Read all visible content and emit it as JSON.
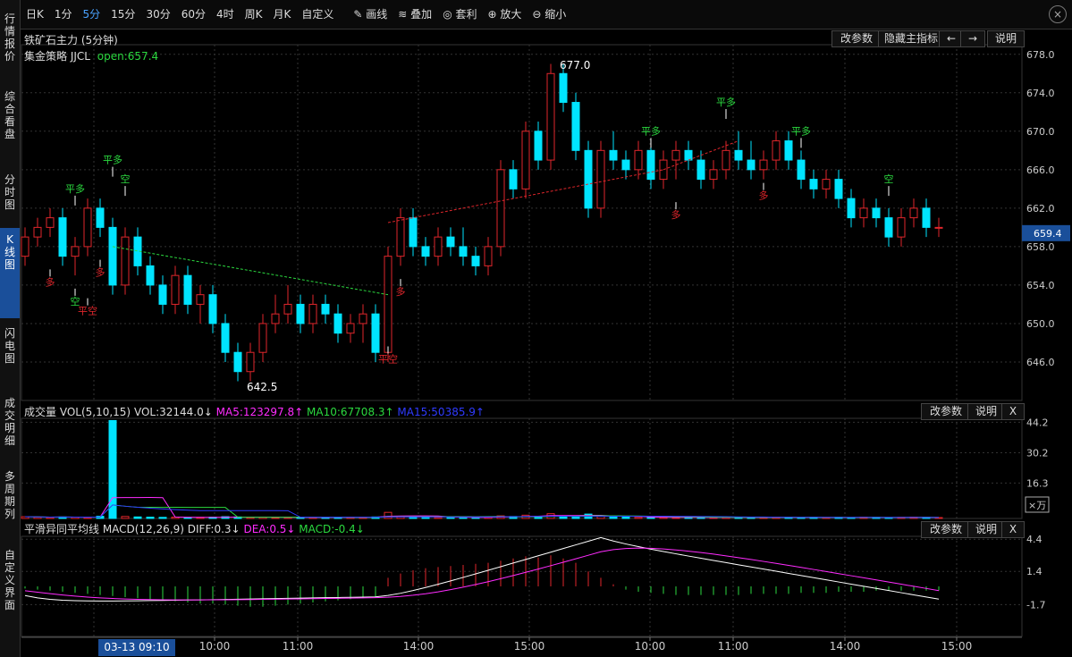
{
  "toolbar": {
    "items": [
      "日K",
      "1分",
      "5分",
      "15分",
      "30分",
      "60分",
      "4时",
      "周K",
      "月K",
      "自定义",
      "画线",
      "叠加",
      "套利",
      "放大",
      "缩小"
    ],
    "active_index": 2,
    "icons": {
      "10": "pencil-icon",
      "11": "layers-icon",
      "12": "coin-icon",
      "13": "zoom-in-icon",
      "14": "zoom-out-icon"
    }
  },
  "sidebar": [
    {
      "label": "行情报价",
      "name": "sidebar-quote"
    },
    {
      "label": "综合看盘",
      "name": "sidebar-overview"
    },
    {
      "label": "分时图",
      "name": "sidebar-timeshare"
    },
    {
      "label": "K线图",
      "name": "sidebar-kline",
      "active": true
    },
    {
      "label": "闪电图",
      "name": "sidebar-flash"
    },
    {
      "label": "成交明细",
      "name": "sidebar-trades"
    },
    {
      "label": "多周期列",
      "name": "sidebar-multiperiod"
    },
    {
      "label": "自定义界面",
      "name": "sidebar-custom"
    }
  ],
  "main": {
    "title": "铁矿石主力 (5分钟)",
    "strategy": "集金策略 JJCL",
    "open_label": "open:657.4",
    "buttons": [
      "改参数",
      "隐藏主指标",
      "←",
      "→",
      "说明"
    ],
    "price_axis": [
      "678.0",
      "674.0",
      "670.0",
      "666.0",
      "662.0",
      "658.0",
      "654.0",
      "650.0",
      "646.0"
    ],
    "current_price": "659.4",
    "high_label": "677.0",
    "low_label": "642.5"
  },
  "volume": {
    "label": "成交量 VOL(5,10,15)",
    "vol": "VOL:32144.0↓",
    "ma5": "MA5:123297.8↑",
    "ma10": "MA10:67708.3↑",
    "ma15": "MA15:50385.9↑",
    "axis": [
      "44.2",
      "30.2",
      "16.3"
    ],
    "unit": "×万",
    "buttons": [
      "改参数",
      "说明",
      "X"
    ]
  },
  "macd": {
    "label": "平滑异同平均线 MACD(12,26,9)",
    "diff": "DIFF:0.3↓",
    "dea": "DEA:0.5↓",
    "macd": "MACD:-0.4↓",
    "axis": [
      "4.4",
      "1.4",
      "-1.7"
    ],
    "buttons": [
      "改参数",
      "说明",
      "X"
    ]
  },
  "time_axis": {
    "labels": [
      "10:00",
      "11:00",
      "14:00",
      "15:00",
      "10:00",
      "11:00",
      "14:00",
      "15:00"
    ],
    "cursor": "03-13 09:10"
  },
  "signals": {
    "duo": "多",
    "kong": "空",
    "pingduo": "平多",
    "pingkong": "平空"
  },
  "colors": {
    "up": "#e0262b",
    "down": "#00e4ff",
    "ma5": "#ff2cff",
    "ma10": "#2bd93f",
    "ma15": "#2f3bff",
    "diff": "#ffffff",
    "dea": "#ff2cff"
  },
  "chart_data": {
    "type": "candlestick",
    "title": "铁矿石主力 (5分钟)",
    "y_range": [
      642,
      679
    ],
    "series": [
      {
        "name": "K线",
        "ohlc": [
          [
            657,
            660,
            656,
            659
          ],
          [
            659,
            661,
            658,
            660
          ],
          [
            660,
            662,
            659,
            661
          ],
          [
            661,
            662,
            656,
            657
          ],
          [
            657,
            659,
            655,
            658
          ],
          [
            658,
            663,
            657,
            662
          ],
          [
            662,
            663,
            659,
            660
          ],
          [
            660,
            661,
            653,
            654
          ],
          [
            654,
            660,
            653,
            659
          ],
          [
            659,
            660,
            655,
            656
          ],
          [
            656,
            657,
            653,
            654
          ],
          [
            654,
            655,
            651,
            652
          ],
          [
            652,
            656,
            651,
            655
          ],
          [
            655,
            656,
            651,
            652
          ],
          [
            652,
            654,
            650,
            653
          ],
          [
            653,
            654,
            649,
            650
          ],
          [
            650,
            651,
            646,
            647
          ],
          [
            647,
            648,
            644,
            645
          ],
          [
            645,
            648,
            644,
            647
          ],
          [
            647,
            651,
            646,
            650
          ],
          [
            650,
            653,
            649,
            651
          ],
          [
            651,
            654,
            650,
            652
          ],
          [
            652,
            653,
            649,
            650
          ],
          [
            650,
            653,
            649,
            652
          ],
          [
            652,
            653,
            650,
            651
          ],
          [
            651,
            652,
            648,
            649
          ],
          [
            649,
            651,
            648,
            650
          ],
          [
            650,
            652,
            648,
            651
          ],
          [
            651,
            652,
            646,
            647
          ],
          [
            647,
            658,
            646,
            657
          ],
          [
            657,
            662,
            656,
            661
          ],
          [
            661,
            662,
            657,
            658
          ],
          [
            658,
            659,
            656,
            657
          ],
          [
            657,
            660,
            656,
            659
          ],
          [
            659,
            660,
            657,
            658
          ],
          [
            658,
            660,
            656,
            657
          ],
          [
            657,
            658,
            655,
            656
          ],
          [
            656,
            659,
            655,
            658
          ],
          [
            658,
            667,
            657,
            666
          ],
          [
            666,
            667,
            663,
            664
          ],
          [
            664,
            671,
            663,
            670
          ],
          [
            670,
            671,
            666,
            667
          ],
          [
            667,
            677,
            666,
            676
          ],
          [
            676,
            677,
            672,
            673
          ],
          [
            673,
            674,
            667,
            668
          ],
          [
            668,
            669,
            661,
            662
          ],
          [
            662,
            669,
            661,
            668
          ],
          [
            668,
            670,
            666,
            667
          ],
          [
            667,
            668,
            665,
            666
          ],
          [
            666,
            669,
            665,
            668
          ],
          [
            668,
            669,
            664,
            665
          ],
          [
            665,
            668,
            664,
            667
          ],
          [
            667,
            669,
            665,
            668
          ],
          [
            668,
            669,
            666,
            667
          ],
          [
            667,
            668,
            664,
            665
          ],
          [
            665,
            667,
            664,
            666
          ],
          [
            666,
            669,
            665,
            668
          ],
          [
            668,
            670,
            666,
            667
          ],
          [
            667,
            669,
            665,
            666
          ],
          [
            666,
            668,
            665,
            667
          ],
          [
            667,
            670,
            666,
            669
          ],
          [
            669,
            670,
            666,
            667
          ],
          [
            667,
            668,
            664,
            665
          ],
          [
            665,
            666,
            663,
            664
          ],
          [
            664,
            666,
            663,
            665
          ],
          [
            665,
            666,
            662,
            663
          ],
          [
            663,
            664,
            660,
            661
          ],
          [
            661,
            663,
            660,
            662
          ],
          [
            662,
            663,
            660,
            661
          ],
          [
            661,
            662,
            658,
            659
          ],
          [
            659,
            662,
            658,
            661
          ],
          [
            661,
            663,
            660,
            662
          ],
          [
            662,
            663,
            659,
            660
          ],
          [
            660,
            661,
            659,
            660
          ]
        ]
      },
      {
        "name": "VOL",
        "values": [
          0.8,
          0.6,
          0.5,
          0.7,
          0.6,
          0.5,
          1.0,
          45.0,
          0.9,
          0.7,
          0.6,
          0.5,
          0.6,
          0.4,
          0.5,
          0.6,
          0.8,
          0.7,
          0.5,
          0.6,
          0.4,
          0.5,
          0.6,
          0.5,
          0.4,
          0.5,
          0.6,
          0.5,
          0.7,
          2.8,
          1.0,
          0.8,
          0.6,
          0.5,
          0.6,
          0.5,
          0.4,
          0.6,
          1.2,
          0.9,
          1.5,
          1.0,
          2.2,
          1.1,
          0.8,
          2.0,
          1.0,
          0.7,
          0.6,
          0.5,
          0.6,
          0.5,
          0.4,
          0.6,
          0.5,
          0.4,
          0.6,
          0.5,
          0.4,
          0.5,
          0.6,
          0.5,
          0.4,
          0.5,
          0.4,
          0.5,
          0.4,
          0.6,
          0.5,
          0.4,
          0.5,
          0.6,
          0.5,
          0.4
        ]
      },
      {
        "name": "MACD",
        "values": [
          -0.2,
          -0.3,
          -0.4,
          -0.5,
          -0.6,
          -0.7,
          -0.8,
          -0.9,
          -1.0,
          -1.1,
          -1.2,
          -1.3,
          -1.4,
          -1.5,
          -1.6,
          -1.6,
          -1.7,
          -1.8,
          -1.9,
          -1.9,
          -1.8,
          -1.7,
          -1.6,
          -1.5,
          -1.4,
          -1.3,
          -1.2,
          -1.1,
          -1.0,
          0.8,
          1.2,
          1.5,
          1.7,
          1.8,
          1.9,
          2.0,
          2.1,
          2.2,
          2.4,
          2.6,
          2.8,
          2.7,
          2.9,
          2.6,
          2.2,
          1.4,
          0.8,
          0.2,
          -0.3,
          -0.5,
          -0.6,
          -0.7,
          -0.8,
          -0.8,
          -0.8,
          -0.8,
          -0.8,
          -0.8,
          -0.7,
          -0.7,
          -0.7,
          -0.7,
          -0.6,
          -0.6,
          -0.6,
          -0.5,
          -0.5,
          -0.5,
          -0.4,
          -0.4,
          -0.4,
          -0.4,
          -0.4,
          -0.4
        ]
      }
    ]
  }
}
